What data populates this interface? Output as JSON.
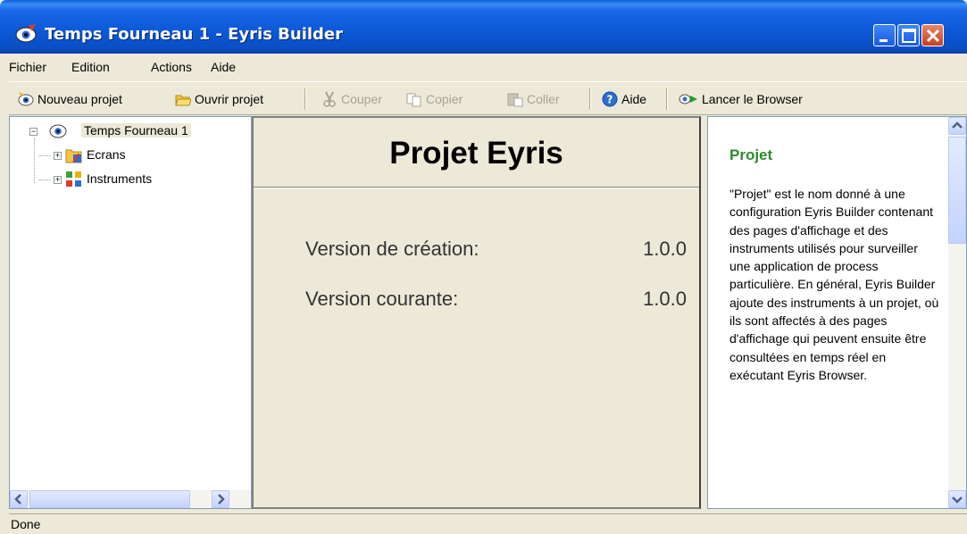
{
  "window": {
    "title": "Temps Fourneau 1 - Eyris Builder"
  },
  "menu": [
    "Fichier",
    "Edition",
    "Actions",
    "Aide"
  ],
  "toolbar": {
    "new_project": "Nouveau projet",
    "open_project": "Ouvrir projet",
    "cut": "Couper",
    "copy": "Copier",
    "paste": "Coller",
    "help": "Aide",
    "launch_browser": "Lancer le Browser"
  },
  "tree": {
    "root": "Temps Fourneau 1",
    "children": [
      "Ecrans",
      "Instruments"
    ]
  },
  "center": {
    "title": "Projet Eyris",
    "creation_label": "Version de création:",
    "creation_value": "1.0.0",
    "current_label": "Version courante:",
    "current_value": "1.0.0"
  },
  "help": {
    "title": "Projet",
    "text": "\"Projet\" est le nom donné à une configuration Eyris Builder contenant des pages d'affichage et des instruments utilisés pour surveiller une application de process particulière. En général, Eyris Builder ajoute des instruments à un projet, où ils sont affectés à des pages d'affichage qui peuvent ensuite être consultées en temps réel en exécutant Eyris Browser."
  },
  "status": {
    "text": "Done"
  },
  "colors": {
    "titlebar": "#0b58d6",
    "help_title": "#2e8b2e",
    "window_bg": "#ece9d8"
  }
}
